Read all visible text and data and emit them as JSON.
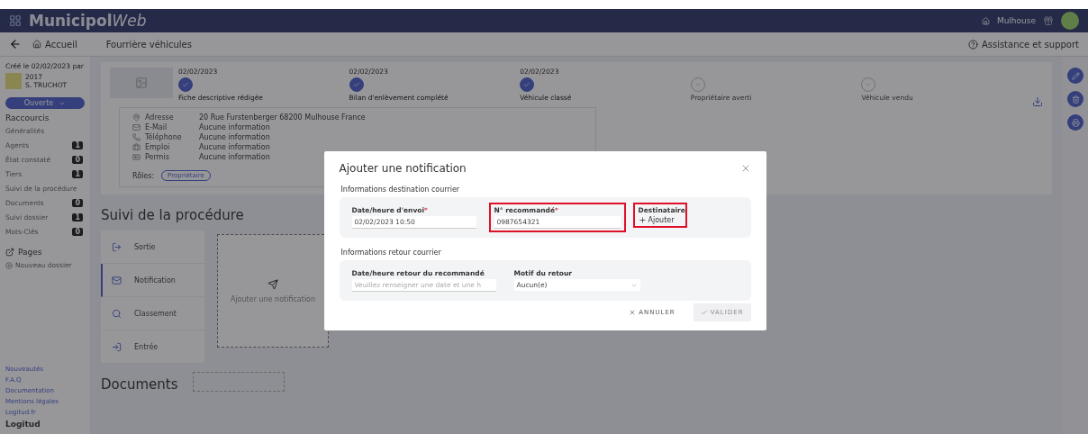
{
  "header": {
    "brand": "Municipol",
    "brand_suffix": "Web",
    "city": "Mulhouse"
  },
  "breadcrumb": {
    "home": "Accueil",
    "current": "Fourrière véhicules",
    "support": "Assistance et support"
  },
  "sidebar": {
    "created": "Créé le 02/02/2023 par",
    "user_id": "2017",
    "user_name": "S. TRUCHOT",
    "status": "Ouverte",
    "shortcuts_title": "Raccourcis",
    "items": [
      {
        "label": "Généralités"
      },
      {
        "label": "Agents",
        "count": "1"
      },
      {
        "label": "État constaté",
        "count": "0"
      },
      {
        "label": "Tiers",
        "count": "1"
      },
      {
        "label": "Suivi de la procédure"
      },
      {
        "label": "Documents",
        "count": "0"
      },
      {
        "label": "Suivi dossier",
        "count": "1"
      },
      {
        "label": "Mots-Clés",
        "count": "0"
      }
    ],
    "pages_title": "Pages",
    "new_folder": "Nouveau dossier",
    "links": [
      "Nouveautés",
      "F.A.Q",
      "Documentation",
      "Mentions légales",
      "Logitud.fr"
    ],
    "logo": "Logitud"
  },
  "timeline": [
    {
      "date": "02/02/2023",
      "label": "Fiche descriptive rédigée",
      "done": true
    },
    {
      "date": "02/02/2023",
      "label": "Bilan d'enlèvement complété",
      "done": true
    },
    {
      "date": "02/02/2023",
      "label": "Véhicule classé",
      "done": true
    },
    {
      "label": "Propriétaire averti",
      "done": false
    },
    {
      "label": "Véhicule vendu",
      "done": false
    }
  ],
  "contact": {
    "rows": [
      {
        "kind": "address",
        "label": "Adresse",
        "value": "20 Rue Furstenberger 68200 Mulhouse France"
      },
      {
        "kind": "mail",
        "label": "E-Mail",
        "value": "Aucune information"
      },
      {
        "kind": "phone",
        "label": "Téléphone",
        "value": "Aucune information"
      },
      {
        "kind": "job",
        "label": "Emploi",
        "value": "Aucune information"
      },
      {
        "kind": "licence",
        "label": "Permis",
        "value": "Aucune information"
      }
    ],
    "roles_label": "Rôles:",
    "roles": [
      "Propriétaire"
    ]
  },
  "procedure": {
    "title": "Suivi de la procédure",
    "steps": [
      {
        "kind": "exit",
        "label": "Sortie",
        "selected": false
      },
      {
        "kind": "mail",
        "label": "Notification",
        "selected": true
      },
      {
        "kind": "search",
        "label": "Classement",
        "selected": false
      },
      {
        "kind": "entry",
        "label": "Entrée",
        "selected": false
      }
    ],
    "add_label": "Ajouter une notification"
  },
  "documents": {
    "title": "Documents"
  },
  "modal": {
    "title": "Ajouter une notification",
    "sections": [
      {
        "title": "Informations destination courrier",
        "fields": [
          {
            "kind": "input",
            "label": "Date/heure d'envoi",
            "required_mark": "*",
            "value": "02/02/2023 10:50",
            "highlighted": false
          },
          {
            "kind": "input",
            "label": "N° recommandé",
            "required_mark": "*",
            "value": "0987654321",
            "highlighted": true
          },
          {
            "kind": "add",
            "label": "Destinataire",
            "action": "Ajouter",
            "highlighted": true
          }
        ]
      },
      {
        "title": "Informations retour courrier",
        "fields": [
          {
            "kind": "input",
            "label": "Date/heure retour du recommandé",
            "placeholder": "Veuillez renseigner une date et une h",
            "highlighted": false
          },
          {
            "kind": "select",
            "label": "Motif du retour",
            "value": "Aucun(e)",
            "highlighted": false
          }
        ]
      }
    ],
    "cancel": "ANNULER",
    "submit": "VALIDER",
    "submit_disabled": true
  }
}
